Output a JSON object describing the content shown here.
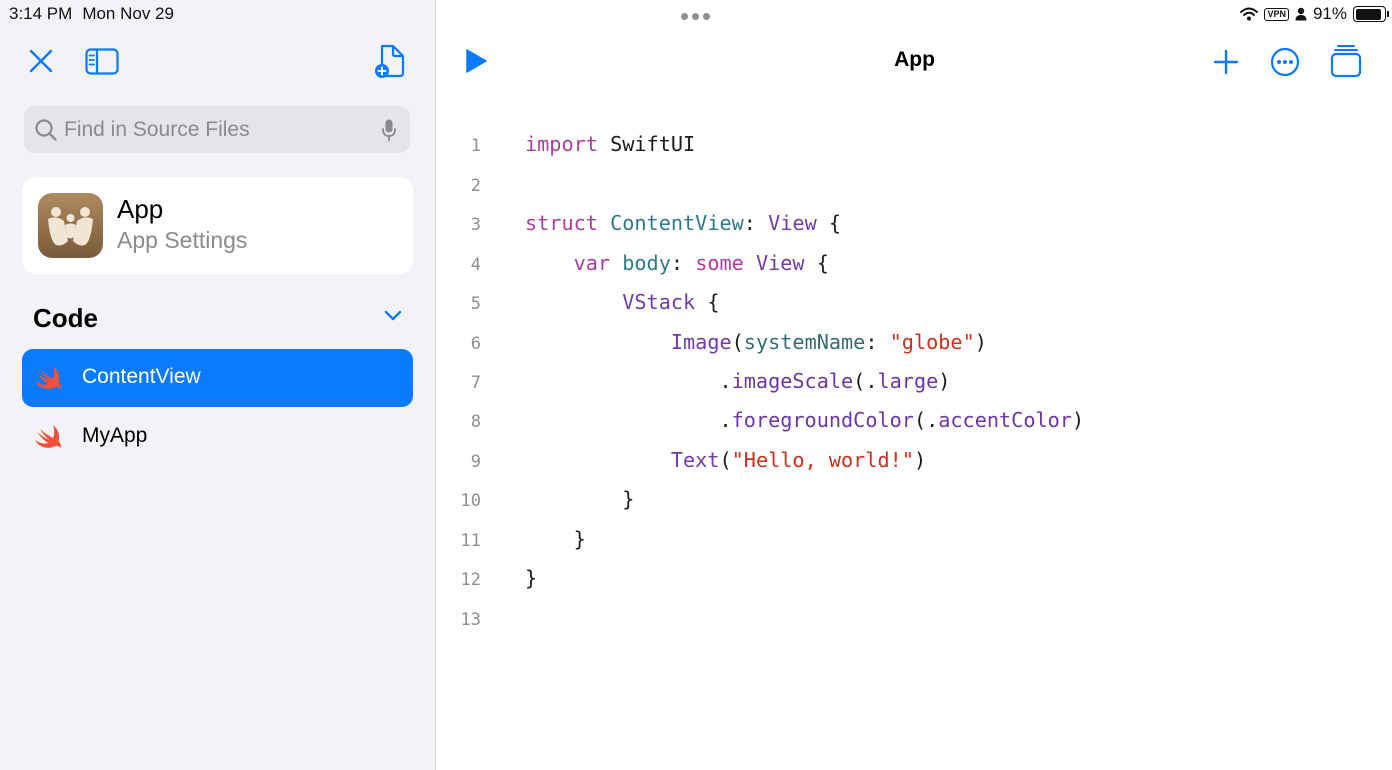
{
  "status_bar": {
    "time": "3:14 PM",
    "date": "Mon Nov 29",
    "vpn_label": "VPN",
    "battery_percent": "91%",
    "battery_level": 0.91
  },
  "sidebar": {
    "search": {
      "placeholder": "Find in Source Files",
      "value": ""
    },
    "app_card": {
      "name": "App",
      "subtitle": "App Settings"
    },
    "code_section": {
      "title": "Code",
      "files": [
        {
          "label": "ContentView",
          "selected": true
        },
        {
          "label": "MyApp",
          "selected": false
        }
      ]
    }
  },
  "editor": {
    "title": "App",
    "line_numbers": [
      "1",
      "2",
      "3",
      "4",
      "5",
      "6",
      "7",
      "8",
      "9",
      "10",
      "11",
      "12",
      "13"
    ],
    "code": {
      "l1": {
        "a": "import",
        "b": " SwiftUI"
      },
      "l3": {
        "a": "struct",
        "b": " ",
        "c": "ContentView",
        "d": ": ",
        "e": "View",
        "f": " {"
      },
      "l4": {
        "a": "    ",
        "b": "var",
        "c": " ",
        "d": "body",
        "e": ": ",
        "f": "some",
        "g": " ",
        "h": "View",
        "i": " {"
      },
      "l5": {
        "a": "        ",
        "b": "VStack",
        "c": " {"
      },
      "l6": {
        "a": "            ",
        "b": "Image",
        "c": "(",
        "d": "systemName",
        "e": ": ",
        "f": "\"globe\"",
        "g": ")"
      },
      "l7": {
        "a": "                .",
        "b": "imageScale",
        "c": "(.",
        "d": "large",
        "e": ")"
      },
      "l8": {
        "a": "                .",
        "b": "foregroundColor",
        "c": "(.",
        "d": "accentColor",
        "e": ")"
      },
      "l9": {
        "a": "            ",
        "b": "Text",
        "c": "(",
        "d": "\"Hello, world!\"",
        "e": ")"
      },
      "l10": {
        "a": "        }"
      },
      "l11": {
        "a": "    }"
      },
      "l12": {
        "a": "}"
      }
    }
  },
  "colors": {
    "accent": "#0a7aff",
    "swift_orange": "#f05138",
    "keyword": "#ad3da4",
    "string": "#d12f1b",
    "type": "#2f7a8a"
  },
  "icons": [
    "close-icon",
    "sidebar-toggle-icon",
    "new-file-icon",
    "search-icon",
    "microphone-icon",
    "chevron-down-icon",
    "swift-icon",
    "run-icon",
    "add-icon",
    "more-icon",
    "windows-icon",
    "wifi-icon",
    "person-icon",
    "battery-icon"
  ]
}
